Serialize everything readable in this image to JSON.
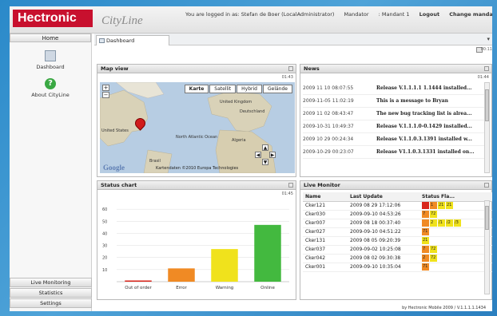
{
  "header": {
    "logo": "Hectronic",
    "app_title": "CityLine",
    "logged_in": "You are logged in as: Stefan de Boer (LocalAdministrator)",
    "mandator_label": "Mandator",
    "mandator_value": ": Mandant 1",
    "logout": "Logout",
    "change_mandator": "Change mandator"
  },
  "sidebar": {
    "home": "Home",
    "items": [
      {
        "label": "Dashboard",
        "icon": "dashboard-icon"
      },
      {
        "label": "About CityLine",
        "icon": "help-icon"
      }
    ],
    "bottom": [
      "Live Monitoring",
      "Statistics",
      "Settings"
    ]
  },
  "tabs": [
    {
      "label": "Dashboard"
    }
  ],
  "toolbar": {
    "refresh_value": "00:11"
  },
  "map": {
    "title": "Map view",
    "counter": "01:43",
    "types": [
      "Karte",
      "Satellit",
      "Hybrid",
      "Gelände"
    ],
    "labels": [
      {
        "text": "United Kingdom"
      },
      {
        "text": "Deutschland"
      },
      {
        "text": "United States"
      },
      {
        "text": "North Atlantic Ocean"
      },
      {
        "text": "Algeria"
      },
      {
        "text": "Brasil"
      }
    ],
    "copyright": "Kartendaten ©2010 Europa Technologies",
    "google": "Google"
  },
  "news": {
    "title": "News",
    "counter": "01:44",
    "items": [
      {
        "date": "2009 11 10 08:07:55",
        "text": "Release V.1.1.1.1 1.1444 installed..."
      },
      {
        "date": "2009-11-05 11:02:19",
        "text": "This is a message to Bryan"
      },
      {
        "date": "2009 11 02 08:43:47",
        "text": "The new bug tracking list is alrea..."
      },
      {
        "date": "2009-10-31 10:49:37",
        "text": "Release V.1.1.1.0-0.1429 installed..."
      },
      {
        "date": "2009 10 29 00:24:34",
        "text": "Release V.1.1.0.3.1391 installed w..."
      },
      {
        "date": "2009-10-29 00:23:07",
        "text": "Release V1.1.0.3.1331 installed on..."
      }
    ]
  },
  "status_chart": {
    "title": "Status chart",
    "counter": "01:45"
  },
  "chart_data": {
    "type": "bar",
    "categories": [
      "Out of order",
      "Error",
      "Warning",
      "Online"
    ],
    "values": [
      1,
      11,
      27,
      47
    ],
    "colors": [
      "#d9261c",
      "#f08a24",
      "#f0e21c",
      "#43b93f"
    ],
    "ylim": [
      0,
      70
    ],
    "yticks": [
      10,
      20,
      30,
      40,
      50,
      60
    ],
    "xlabel": "",
    "ylabel": ""
  },
  "live_monitor": {
    "title": "Live Monitor",
    "counter": "01:47",
    "columns": [
      "Name",
      "Last Update",
      "Status Fla..."
    ],
    "rows": [
      {
        "name": "Cker121",
        "update": "2009 08 29 17:12:06",
        "flags": [
          {
            "t": "",
            "c": "#d9261c"
          },
          {
            "t": "1",
            "c": "#f08a24"
          },
          {
            "t": "21",
            "c": "#f0e21c"
          },
          {
            "t": "21",
            "c": "#f0e21c"
          }
        ]
      },
      {
        "name": "Cker030",
        "update": "2009-09-10 04:53:26",
        "flags": [
          {
            "t": "7",
            "c": "#f08a24"
          },
          {
            "t": "72",
            "c": "#f0e21c"
          }
        ]
      },
      {
        "name": "Cker007",
        "update": "2009 08 18 00:37:40",
        "flags": [
          {
            "t": "",
            "c": "#f08a24"
          },
          {
            "t": "2",
            "c": "#f0e21c"
          },
          {
            "t": "/1",
            "c": "#f0e21c"
          },
          {
            "t": "/2",
            "c": "#f0e21c"
          },
          {
            "t": "/3",
            "c": "#f0e21c"
          }
        ]
      },
      {
        "name": "Cker027",
        "update": "2009-09-10 04:51:22",
        "flags": [
          {
            "t": "71",
            "c": "#f08a24"
          }
        ]
      },
      {
        "name": "Cker131",
        "update": "2009 08 05 09:20:39",
        "flags": [
          {
            "t": "21",
            "c": "#f0e21c"
          }
        ]
      },
      {
        "name": "Cker037",
        "update": "2009-09-02 10:25:08",
        "flags": [
          {
            "t": "7",
            "c": "#f08a24"
          },
          {
            "t": "72",
            "c": "#f0e21c"
          }
        ]
      },
      {
        "name": "Cker042",
        "update": "2009 08 02 09:30:38",
        "flags": [
          {
            "t": "2",
            "c": "#f08a24"
          },
          {
            "t": "72",
            "c": "#f0e21c"
          }
        ]
      },
      {
        "name": "Cker001",
        "update": "2009-09-10 10:35:04",
        "flags": [
          {
            "t": "71",
            "c": "#f08a24"
          }
        ]
      }
    ]
  },
  "footer": {
    "text": "by Hectronic Mobile 2009 / V.1.1.1.1.1434"
  }
}
